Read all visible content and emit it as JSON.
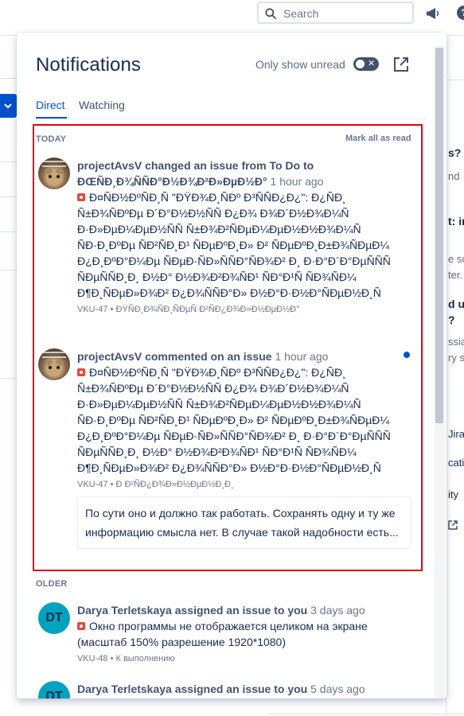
{
  "header": {
    "search_placeholder": "Search",
    "help_glyph": "?"
  },
  "background_fragments": [
    "s?",
    "nd",
    "t: in",
    "e sc",
    "ter.",
    "d us",
    "?",
    "ssian",
    "ry st",
    "Jira",
    "cati",
    "ity"
  ],
  "panel": {
    "title": "Notifications",
    "only_unread_label": "Only show unread",
    "toggle_state": "off",
    "tabs": [
      {
        "label": "Direct",
        "active": true
      },
      {
        "label": "Watching",
        "active": false
      }
    ],
    "today_label": "TODAY",
    "mark_all_read": "Mark all as read",
    "older_label": "OLDER",
    "items": [
      {
        "user": "projectAvsV",
        "verb": "changed an issue from To Do to",
        "verb_tail": "ÐŒÑÐ¸Ð¾ÑÑÐ°Ð½Ð¾Ð²Ð»ÐµÐ½Ð°",
        "time": "1 hour ago",
        "issue_title": "Ð¤ÑÐ½ÐºÑÐ¸Ñ \"ÐŸÐ¾Ð¸ÑÐº Ð³ÑÑÐ¿Ð¿\": Ð¿ÑÐ¸ Ñ±Ð¾ÑÐºÐµ Ð´Ð°Ð½Ð½ÑÑ Ð¿Ð¾ Ð¾Ð´Ð½Ð¾Ð¼Ñ Ð·Ð»ÐµÐ¼ÐµÐ½ÑÑ Ñ±Ð¾Ð²ÑÐµÐ¼ÐµÐ½Ð½Ð¾Ð¼Ñ ÑÐ·Ð¸ÐºÐµ ÑÐ²ÑÐ¸Ð¹ ÑÐµÐºÐ¸Ð» Ð² ÑÐµÐºÐ¸Ð±Ð¾ÑÐµÐ¼ Ð¿Ð¸ÐºÐ°Ð¼Ðµ ÑÐµÐ·ÑÐ»ÑÑÐ°ÑÐ¾Ð² Ð¸ Ð·Ð°Ð´Ð°ÐµÑÑÑ ÑÐµÑÑÐ¸Ð¸ Ð½Ð° Ð½Ð¾Ð²Ð¾ÑÐ¹ ÑÐ°Ð¹Ñ ÑÐ¾ÑÐ¼ Ð¶Ð¸ÑÐµÐ»Ð¾Ð² Ð¿Ð¾ÑÑÐ°Ð» Ð½Ð°Ð·Ð½Ð°ÑÐµÐ½Ð¸Ñ",
        "key": "VKU-47",
        "status": "ÐŸÑÐ¸Ð¾ÑÐ¸ÑÐµÑ Ð²ÑÐ¿Ð¾Ð»Ð½ÐµÐ½Ð°",
        "avatar": "cat",
        "unread": false
      },
      {
        "user": "projectAvsV",
        "verb": "commented on an issue",
        "time": "1 hour ago",
        "issue_title": "Ð¤ÑÐ½ÐºÑÐ¸Ñ \"ÐŸÐ¾Ð¸ÑÐº Ð³ÑÑÐ¿Ð¿\": Ð¿ÑÐ¸ Ñ±Ð¾ÑÐºÐµ Ð´Ð°Ð½Ð½ÑÑ Ð¿Ð¾ Ð¾Ð´Ð½Ð¾Ð¼Ñ Ð·Ð»ÐµÐ¼ÐµÐ½ÑÑ Ñ±Ð¾Ð²ÑÐµÐ¼ÐµÐ½Ð½Ð¾Ð¼Ñ ÑÐ·Ð¸ÐºÐµ ÑÐ²ÑÐ¸Ð¹ ÑÐµÐºÐ¸Ð» Ð² ÑÐµÐºÐ¸Ð±Ð¾ÑÐµÐ¼ Ð¿Ð¸ÐºÐ°Ð¼Ðµ ÑÐµÐ·ÑÐ»ÑÑÐ°ÑÐ¾Ð² Ð¸ Ð·Ð°Ð´Ð°ÐµÑÑÑ ÑÐµÑÑÐ¸Ð¸ Ð½Ð° Ð½Ð¾Ð²Ð¾ÑÐ¹ ÑÐ°Ð¹Ñ ÑÐ¾ÑÐ¼ Ð¶Ð¸ÑÐµÐ»Ð¾Ð² Ð¿Ð¾ÑÑÐ°Ð» Ð½Ð°Ð·Ð½Ð°ÑÐµÐ½Ð¸Ñ",
        "key": "VKU-47",
        "status": "Ð Ð²ÑÐ¿Ð¾Ð»Ð½ÐµÐ½Ð¸Ð¸",
        "avatar": "cat",
        "unread": true,
        "comment": "По сути оно и должно так работать. Сохранять одну и ту же информацию смысла нет. В случае такой надобности есть..."
      },
      {
        "user": "Darya Terletskaya",
        "verb": "assigned an issue to you",
        "time": "3 days ago",
        "issue_title": "Окно программы не отображается целиком на экране (масштаб 150% разрешение 1920*1080)",
        "key": "VKU-48",
        "status": "К выполнению",
        "avatar": "DT",
        "unread": false
      },
      {
        "user": "Darya Terletskaya",
        "verb": "assigned an issue to you",
        "time": "5 days ago",
        "avatar": "DT",
        "unread": false
      }
    ]
  },
  "colors": {
    "accent": "#0052cc",
    "highlight_border": "#e2000f",
    "bug_icon": "#e5493a",
    "avatar_dt": "#00a3bf"
  }
}
